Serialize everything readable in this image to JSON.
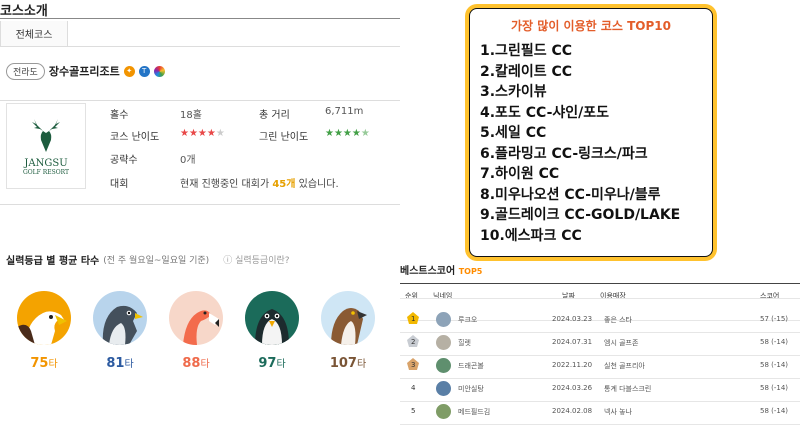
{
  "section": {
    "title": "코스소개",
    "tab_all": "전체코스"
  },
  "course": {
    "region": "전라도",
    "name": "장수골프리조트",
    "badges": [
      "orange-badge",
      "blue-badge",
      "rainbow-badge"
    ],
    "logo": {
      "name": "JANGSU",
      "sub": "GOLF RESORT"
    },
    "holes_label": "홀수",
    "holes_value": "18홀",
    "distance_label": "총 거리",
    "distance_value": "6,711m",
    "difficulty_label": "코스 난이도",
    "difficulty_stars": "★★★★★",
    "green_label": "그린 난이도",
    "green_stars": "★★★★★",
    "strategy_label": "공략수",
    "strategy_value": "0개",
    "tournament_label": "대회",
    "tournament_prefix": "현재 진행중인 대회가 ",
    "tournament_count": "45개",
    "tournament_suffix": " 있습니다."
  },
  "levels": {
    "title": "실력등급 별 평균 타수",
    "subtitle": "(전 주 월요일~일요일 기준)",
    "help": "실력등급이란?",
    "items": [
      {
        "score": "75",
        "unit": "타",
        "color": "#f29400",
        "name": "eagle"
      },
      {
        "score": "81",
        "unit": "타",
        "color": "#2c5aa0",
        "name": "falcon"
      },
      {
        "score": "88",
        "unit": "타",
        "color": "#ef6b4c",
        "name": "flamingo"
      },
      {
        "score": "97",
        "unit": "타",
        "color": "#1c6b5b",
        "name": "penguin"
      },
      {
        "score": "107",
        "unit": "타",
        "color": "#7a5536",
        "name": "osprey"
      }
    ]
  },
  "top10": {
    "title": "가장 많이 이용한 코스 TOP10",
    "items": [
      "1.그린필드 CC",
      "2.칼레이트 CC",
      "3.스카이뷰",
      "4.포도 CC-샤인/포도",
      "5.세일 CC",
      "6.플라밍고 CC-링크스/파크",
      "7.하이원 CC",
      "8.미우나오션 CC-미우나/블루",
      "9.골드레이크 CC-GOLD/LAKE",
      "10.에스파크 CC"
    ]
  },
  "best": {
    "title": "베스트스코어",
    "tag": "TOP5",
    "headers": {
      "rank": "순위",
      "nick": "닉네임",
      "date": "날짜",
      "venue": "이용매장",
      "score": "스코어"
    },
    "rows": [
      {
        "rank": "1",
        "nick": "루크오",
        "date": "2024.03.23",
        "venue": "좋은 스타",
        "score": "57 (-15)"
      },
      {
        "rank": "2",
        "nick": "힐렛",
        "date": "2024.07.31",
        "venue": "엠시 골프존",
        "score": "58 (-14)"
      },
      {
        "rank": "3",
        "nick": "드래곤볼",
        "date": "2022.11.20",
        "venue": "실천 골프리아",
        "score": "58 (-14)"
      },
      {
        "rank": "4",
        "nick": "미안실탕",
        "date": "2024.03.26",
        "venue": "통계 다블스크린",
        "score": "58 (-14)"
      },
      {
        "rank": "5",
        "nick": "메드필드김",
        "date": "2024.02.08",
        "venue": "넥사 놓나",
        "score": "58 (-14)"
      }
    ]
  }
}
